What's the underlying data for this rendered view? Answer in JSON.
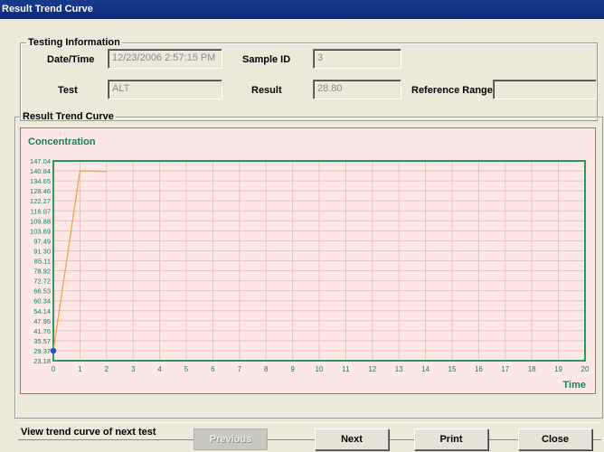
{
  "window": {
    "title": "Result Trend Curve"
  },
  "testing_info": {
    "legend": "Testing Information",
    "datetime_label": "Date/Time",
    "datetime_value": "12/23/2006 2:57:15 PM",
    "sample_id_label": "Sample ID",
    "sample_id_value": "3",
    "test_label": "Test",
    "test_value": "ALT",
    "result_label": "Result",
    "result_value": "28.80",
    "reference_range_label": "Reference Range",
    "reference_range_value": ""
  },
  "trend": {
    "legend": "Result Trend Curve"
  },
  "chart_data": {
    "type": "line",
    "title": "Concentration",
    "xlabel": "Time",
    "ylabel": "Concentration",
    "x_ticks": [
      "0",
      "1",
      "2",
      "3",
      "4",
      "5",
      "6",
      "7",
      "8",
      "9",
      "10",
      "11",
      "12",
      "13",
      "14",
      "15",
      "16",
      "17",
      "18",
      "19",
      "20"
    ],
    "y_ticks": [
      "147.04",
      "140.84",
      "134.65",
      "128.46",
      "122.27",
      "116.07",
      "109.88",
      "103.69",
      "97.49",
      "91.30",
      "85.11",
      "78.92",
      "72.72",
      "66.53",
      "60.34",
      "54.14",
      "47.95",
      "41.76",
      "35.57",
      "29.37",
      "23.18"
    ],
    "xlim": [
      0,
      20
    ],
    "ylim": [
      23.18,
      147.04
    ],
    "grid": true,
    "series": [
      {
        "color": "#f0a050",
        "points": [
          [
            0,
            29.37
          ],
          [
            1,
            140.84
          ],
          [
            2,
            140.5
          ]
        ]
      }
    ],
    "marker": {
      "x": 0,
      "y": 29.37,
      "color": "#1f4fd8"
    }
  },
  "status": {
    "text": "View trend curve of next test"
  },
  "buttons": {
    "previous": "Previous",
    "next": "Next",
    "print": "Print",
    "close": "Close"
  }
}
